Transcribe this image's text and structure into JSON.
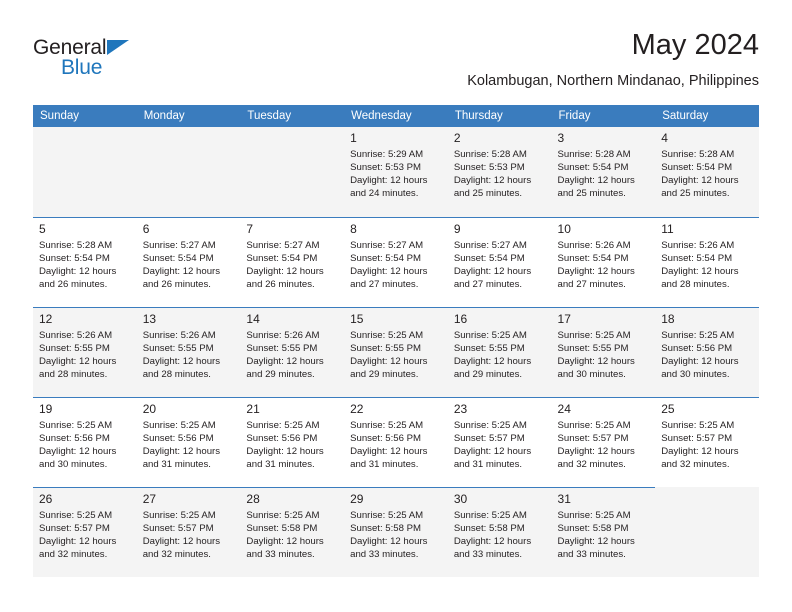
{
  "brand": {
    "name_dark": "General",
    "name_light": "Blue",
    "triangle_color": "#1f76bc",
    "accent_color": "#3a7cbe"
  },
  "header": {
    "title": "May 2024",
    "location": "Kolambugan, Northern Mindanao, Philippines"
  },
  "calendar": {
    "weekday_headers": [
      "Sunday",
      "Monday",
      "Tuesday",
      "Wednesday",
      "Thursday",
      "Friday",
      "Saturday"
    ],
    "labels": {
      "sunrise": "Sunrise:",
      "sunset": "Sunset:",
      "daylight": "Daylight:"
    },
    "weeks": [
      [
        {
          "day": "",
          "sunrise": "",
          "sunset": "",
          "daylight_line1": "",
          "daylight_line2": ""
        },
        {
          "day": "",
          "sunrise": "",
          "sunset": "",
          "daylight_line1": "",
          "daylight_line2": ""
        },
        {
          "day": "",
          "sunrise": "",
          "sunset": "",
          "daylight_line1": "",
          "daylight_line2": ""
        },
        {
          "day": "1",
          "sunrise": "Sunrise: 5:29 AM",
          "sunset": "Sunset: 5:53 PM",
          "daylight_line1": "Daylight: 12 hours",
          "daylight_line2": "and 24 minutes."
        },
        {
          "day": "2",
          "sunrise": "Sunrise: 5:28 AM",
          "sunset": "Sunset: 5:53 PM",
          "daylight_line1": "Daylight: 12 hours",
          "daylight_line2": "and 25 minutes."
        },
        {
          "day": "3",
          "sunrise": "Sunrise: 5:28 AM",
          "sunset": "Sunset: 5:54 PM",
          "daylight_line1": "Daylight: 12 hours",
          "daylight_line2": "and 25 minutes."
        },
        {
          "day": "4",
          "sunrise": "Sunrise: 5:28 AM",
          "sunset": "Sunset: 5:54 PM",
          "daylight_line1": "Daylight: 12 hours",
          "daylight_line2": "and 25 minutes."
        }
      ],
      [
        {
          "day": "5",
          "sunrise": "Sunrise: 5:28 AM",
          "sunset": "Sunset: 5:54 PM",
          "daylight_line1": "Daylight: 12 hours",
          "daylight_line2": "and 26 minutes."
        },
        {
          "day": "6",
          "sunrise": "Sunrise: 5:27 AM",
          "sunset": "Sunset: 5:54 PM",
          "daylight_line1": "Daylight: 12 hours",
          "daylight_line2": "and 26 minutes."
        },
        {
          "day": "7",
          "sunrise": "Sunrise: 5:27 AM",
          "sunset": "Sunset: 5:54 PM",
          "daylight_line1": "Daylight: 12 hours",
          "daylight_line2": "and 26 minutes."
        },
        {
          "day": "8",
          "sunrise": "Sunrise: 5:27 AM",
          "sunset": "Sunset: 5:54 PM",
          "daylight_line1": "Daylight: 12 hours",
          "daylight_line2": "and 27 minutes."
        },
        {
          "day": "9",
          "sunrise": "Sunrise: 5:27 AM",
          "sunset": "Sunset: 5:54 PM",
          "daylight_line1": "Daylight: 12 hours",
          "daylight_line2": "and 27 minutes."
        },
        {
          "day": "10",
          "sunrise": "Sunrise: 5:26 AM",
          "sunset": "Sunset: 5:54 PM",
          "daylight_line1": "Daylight: 12 hours",
          "daylight_line2": "and 27 minutes."
        },
        {
          "day": "11",
          "sunrise": "Sunrise: 5:26 AM",
          "sunset": "Sunset: 5:54 PM",
          "daylight_line1": "Daylight: 12 hours",
          "daylight_line2": "and 28 minutes."
        }
      ],
      [
        {
          "day": "12",
          "sunrise": "Sunrise: 5:26 AM",
          "sunset": "Sunset: 5:55 PM",
          "daylight_line1": "Daylight: 12 hours",
          "daylight_line2": "and 28 minutes."
        },
        {
          "day": "13",
          "sunrise": "Sunrise: 5:26 AM",
          "sunset": "Sunset: 5:55 PM",
          "daylight_line1": "Daylight: 12 hours",
          "daylight_line2": "and 28 minutes."
        },
        {
          "day": "14",
          "sunrise": "Sunrise: 5:26 AM",
          "sunset": "Sunset: 5:55 PM",
          "daylight_line1": "Daylight: 12 hours",
          "daylight_line2": "and 29 minutes."
        },
        {
          "day": "15",
          "sunrise": "Sunrise: 5:25 AM",
          "sunset": "Sunset: 5:55 PM",
          "daylight_line1": "Daylight: 12 hours",
          "daylight_line2": "and 29 minutes."
        },
        {
          "day": "16",
          "sunrise": "Sunrise: 5:25 AM",
          "sunset": "Sunset: 5:55 PM",
          "daylight_line1": "Daylight: 12 hours",
          "daylight_line2": "and 29 minutes."
        },
        {
          "day": "17",
          "sunrise": "Sunrise: 5:25 AM",
          "sunset": "Sunset: 5:55 PM",
          "daylight_line1": "Daylight: 12 hours",
          "daylight_line2": "and 30 minutes."
        },
        {
          "day": "18",
          "sunrise": "Sunrise: 5:25 AM",
          "sunset": "Sunset: 5:56 PM",
          "daylight_line1": "Daylight: 12 hours",
          "daylight_line2": "and 30 minutes."
        }
      ],
      [
        {
          "day": "19",
          "sunrise": "Sunrise: 5:25 AM",
          "sunset": "Sunset: 5:56 PM",
          "daylight_line1": "Daylight: 12 hours",
          "daylight_line2": "and 30 minutes."
        },
        {
          "day": "20",
          "sunrise": "Sunrise: 5:25 AM",
          "sunset": "Sunset: 5:56 PM",
          "daylight_line1": "Daylight: 12 hours",
          "daylight_line2": "and 31 minutes."
        },
        {
          "day": "21",
          "sunrise": "Sunrise: 5:25 AM",
          "sunset": "Sunset: 5:56 PM",
          "daylight_line1": "Daylight: 12 hours",
          "daylight_line2": "and 31 minutes."
        },
        {
          "day": "22",
          "sunrise": "Sunrise: 5:25 AM",
          "sunset": "Sunset: 5:56 PM",
          "daylight_line1": "Daylight: 12 hours",
          "daylight_line2": "and 31 minutes."
        },
        {
          "day": "23",
          "sunrise": "Sunrise: 5:25 AM",
          "sunset": "Sunset: 5:57 PM",
          "daylight_line1": "Daylight: 12 hours",
          "daylight_line2": "and 31 minutes."
        },
        {
          "day": "24",
          "sunrise": "Sunrise: 5:25 AM",
          "sunset": "Sunset: 5:57 PM",
          "daylight_line1": "Daylight: 12 hours",
          "daylight_line2": "and 32 minutes."
        },
        {
          "day": "25",
          "sunrise": "Sunrise: 5:25 AM",
          "sunset": "Sunset: 5:57 PM",
          "daylight_line1": "Daylight: 12 hours",
          "daylight_line2": "and 32 minutes."
        }
      ],
      [
        {
          "day": "26",
          "sunrise": "Sunrise: 5:25 AM",
          "sunset": "Sunset: 5:57 PM",
          "daylight_line1": "Daylight: 12 hours",
          "daylight_line2": "and 32 minutes."
        },
        {
          "day": "27",
          "sunrise": "Sunrise: 5:25 AM",
          "sunset": "Sunset: 5:57 PM",
          "daylight_line1": "Daylight: 12 hours",
          "daylight_line2": "and 32 minutes."
        },
        {
          "day": "28",
          "sunrise": "Sunrise: 5:25 AM",
          "sunset": "Sunset: 5:58 PM",
          "daylight_line1": "Daylight: 12 hours",
          "daylight_line2": "and 33 minutes."
        },
        {
          "day": "29",
          "sunrise": "Sunrise: 5:25 AM",
          "sunset": "Sunset: 5:58 PM",
          "daylight_line1": "Daylight: 12 hours",
          "daylight_line2": "and 33 minutes."
        },
        {
          "day": "30",
          "sunrise": "Sunrise: 5:25 AM",
          "sunset": "Sunset: 5:58 PM",
          "daylight_line1": "Daylight: 12 hours",
          "daylight_line2": "and 33 minutes."
        },
        {
          "day": "31",
          "sunrise": "Sunrise: 5:25 AM",
          "sunset": "Sunset: 5:58 PM",
          "daylight_line1": "Daylight: 12 hours",
          "daylight_line2": "and 33 minutes."
        },
        {
          "day": "",
          "sunrise": "",
          "sunset": "",
          "daylight_line1": "",
          "daylight_line2": ""
        }
      ]
    ]
  }
}
